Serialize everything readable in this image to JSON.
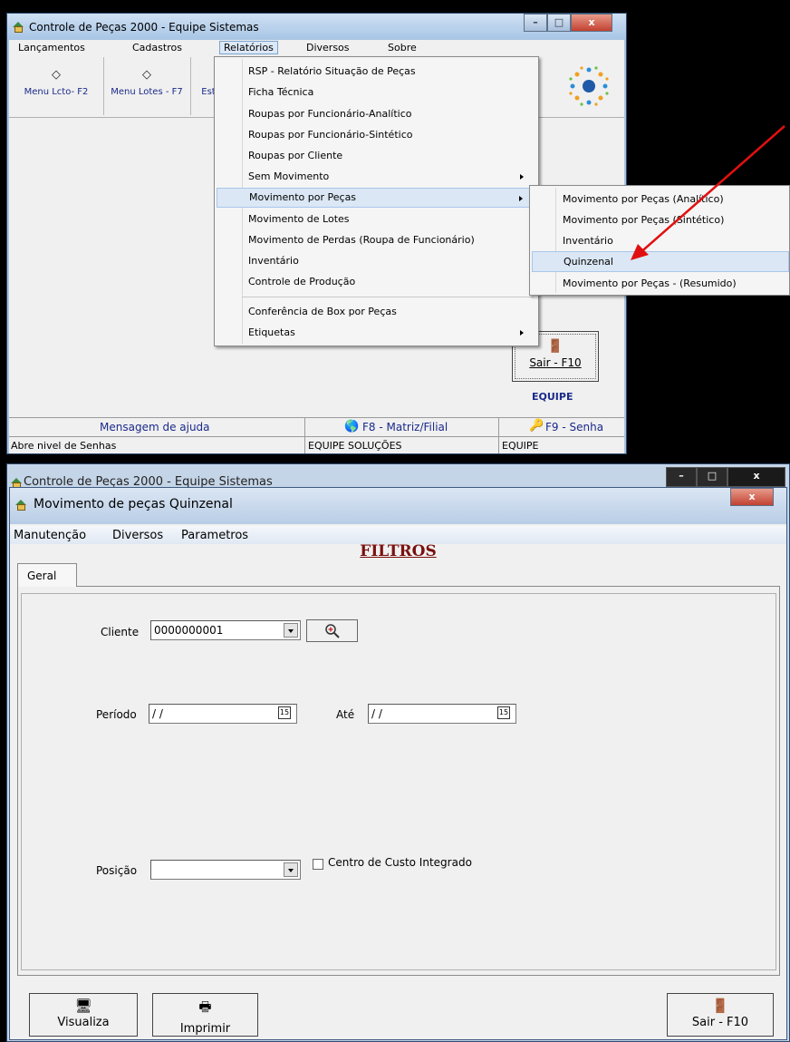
{
  "top_window": {
    "title": "Controle de Peças 2000 - Equipe Sistemas",
    "menubar": [
      "Lançamentos",
      "Cadastros",
      "Relatórios",
      "Diversos",
      "Sobre"
    ],
    "toolbar": [
      {
        "label": "Menu Lcto- F2",
        "icon": "tag-icon"
      },
      {
        "label": "Menu Lotes - F7",
        "icon": "tag-icon"
      },
      {
        "label": "Est",
        "icon": ""
      }
    ],
    "relatorios_menu": [
      "RSP - Relatório Situação de Peças",
      "Ficha Técnica",
      "Roupas por Funcionário-Analítico",
      "Roupas por Funcionário-Sintético",
      "Roupas por Cliente",
      "Sem Movimento",
      "Movimento por Peças",
      "Movimento de Lotes",
      "Movimento de Perdas (Roupa de Funcionário)",
      "Inventário",
      "Controle de Produção",
      "Conferência de Box por Peças",
      "Etiquetas"
    ],
    "movimento_submenu": [
      "Movimento por Peças (Analítico)",
      "Movimento por Peças (Sintético)",
      "Inventário",
      "Quinzenal",
      "Movimento por Peças - (Resumido)"
    ],
    "sair_label": "Sair - F10",
    "brand": "EQUIPE",
    "status": {
      "help": "Mensagem de ajuda",
      "matriz": "F8 - Matriz/Filial",
      "senha": "F9 - Senha",
      "nivel": "Abre nivel de Senhas",
      "company": "EQUIPE SOLUÇÕES",
      "user": "EQUIPE"
    }
  },
  "bottom_window": {
    "background_title": "Controle de Peças 2000 - Equipe Sistemas",
    "title": "Movimento de peças Quinzenal",
    "menubar": [
      "Manutenção",
      "Diversos",
      "Parametros"
    ],
    "heading": "FILTROS",
    "tab": "Geral",
    "fields": {
      "cliente_label": "Cliente",
      "cliente_value": "0000000001",
      "periodo_label": "Período",
      "periodo_value": " / /",
      "ate_label": "Até",
      "ate_value": " / /",
      "posicao_label": "Posição",
      "posicao_value": "",
      "centro_label": "Centro de Custo Integrado"
    },
    "buttons": {
      "visualiza": "Visualiza",
      "imprimir": "Imprimir",
      "sair": "Sair - F10"
    }
  }
}
